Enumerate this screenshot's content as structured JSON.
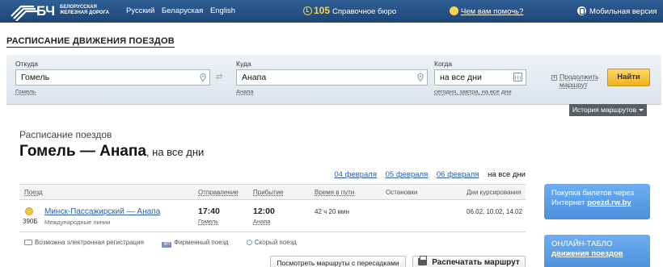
{
  "header": {
    "logo_abbr": "БЧ",
    "logo_sub_1": "Белорусская",
    "logo_sub_2": "железная дорога",
    "languages": [
      "Русский",
      "Беларуская",
      "English"
    ],
    "helpdesk_number": "105",
    "helpdesk_label": "Справочное бюро",
    "help_link": "Чем вам помочь?",
    "mobile_link": "Мобильная версия"
  },
  "page_title": "РАСПИСАНИЕ ДВИЖЕНИЯ ПОЕЗДОВ",
  "search": {
    "from_label": "Откуда",
    "from_value": "Гомель",
    "from_hint": "Гомель",
    "to_label": "Куда",
    "to_value": "Анапа",
    "to_hint": "Анапа",
    "when_label": "Когда",
    "when_value": "на все дни",
    "when_hint": "сегодня, завтра, на все дни",
    "swap_symbol": "⇄",
    "continue_line1": "Продолжить",
    "continue_line2": "маршрут",
    "find_button": "Найти",
    "history_button": "История маршрутов"
  },
  "results": {
    "subtitle": "Расписание поездов",
    "route": "Гомель — Анапа",
    "route_when": ", на все дни",
    "dates": [
      "04 февраля",
      "05 февраля",
      "06 февраля"
    ],
    "current_date": "на все дни",
    "columns": {
      "train": "Поезд",
      "departure": "Отправление",
      "arrival": "Прибытие",
      "duration": "Время в пути",
      "stops": "Остановки",
      "days": "Дни курсирования"
    },
    "rows": [
      {
        "number": "390Б",
        "name": "Минск-Пассажирский — Анапа",
        "kind": "Международные линии",
        "departure_time": "17:40",
        "departure_station": "Гомель",
        "arrival_time": "12:00",
        "arrival_station": "Анапа",
        "duration": "42 ч 20 мин",
        "days": "06.02, 10.02, 14.02"
      }
    ],
    "legend": {
      "electronic_registration": "Возможна электронная регистрация",
      "brand_train_icon_text": "ФП",
      "brand_train": "Фирменный поезд",
      "fast_train": "Скорый поезд"
    },
    "transfers_button": "Посмотреть маршруты с пересадками",
    "print_button": "Распечатать маршрут"
  },
  "promos": {
    "tickets_line1": "Покупка билетов через",
    "tickets_line2": "Интернет",
    "tickets_link": "poezd.rw.by",
    "online_line1": "ОНЛАЙН-ТАБЛО",
    "online_link": "движения поездов"
  },
  "colors": {
    "header_bg": "#1d4677",
    "accent_yellow": "#f0b41c",
    "link_blue": "#2a5ea8",
    "promo_blue": "#4b90dc"
  }
}
